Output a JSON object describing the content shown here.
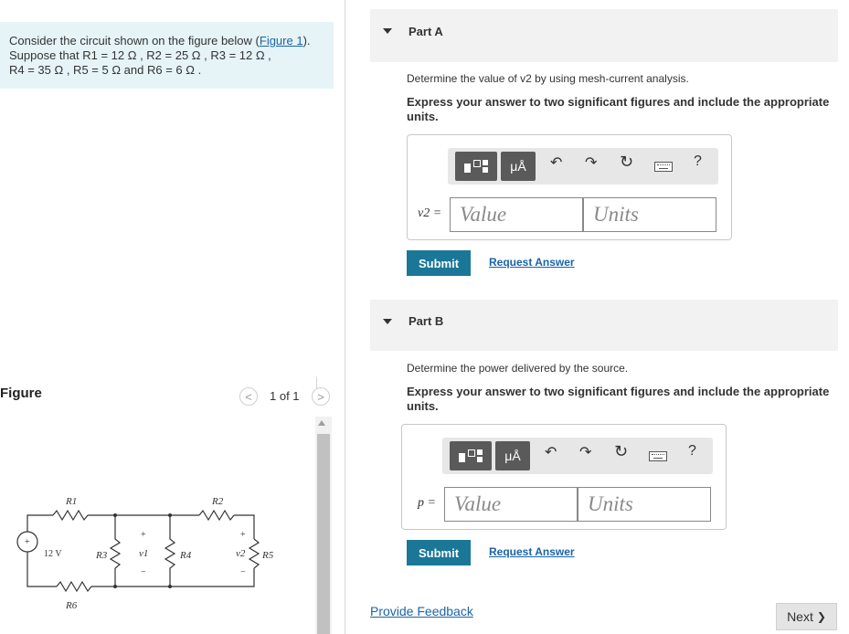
{
  "problem": {
    "line1_prefix": "Consider the circuit shown on the figure below (",
    "figure_link": "Figure 1",
    "line1_suffix": ").",
    "line2": "Suppose that R1 = 12 Ω , R2 = 25 Ω , R3 = 12 Ω ,",
    "line3": "R4 = 35 Ω , R5 = 5 Ω and R6 = 6 Ω ."
  },
  "figure_panel": {
    "label": "Figure",
    "prev": "<",
    "page_indicator": "1 of 1",
    "next": ">",
    "circuit": {
      "source": "12 V",
      "r1": "R1",
      "r2": "R2",
      "r3": "R3",
      "r4": "R4",
      "r5": "R5",
      "r6": "R6",
      "v1": "v1",
      "v2": "v2",
      "plus": "+",
      "minus": "−",
      "src_plus": "+"
    }
  },
  "part_a": {
    "title": "Part A",
    "question": "Determine the value of v2 by using mesh-current analysis.",
    "instruction": "Express your answer to two significant figures and include the appropriate units.",
    "answer_label": "v2 =",
    "value_placeholder": "Value",
    "units_placeholder": "Units",
    "submit": "Submit",
    "request": "Request Answer"
  },
  "part_b": {
    "title": "Part B",
    "question": "Determine the power delivered by the source.",
    "instruction": "Express your answer to two significant figures and include the appropriate units.",
    "answer_label": "p =",
    "value_placeholder": "Value",
    "units_placeholder": "Units",
    "submit": "Submit",
    "request": "Request Answer"
  },
  "toolbar": {
    "mu_a": "μÅ",
    "undo": "↶",
    "redo": "↷",
    "reset": "↻",
    "help": "?",
    "keyboard_icon": "keyboard-icon"
  },
  "footer": {
    "feedback": "Provide Feedback",
    "next": "Next",
    "next_chevron": "❯"
  }
}
